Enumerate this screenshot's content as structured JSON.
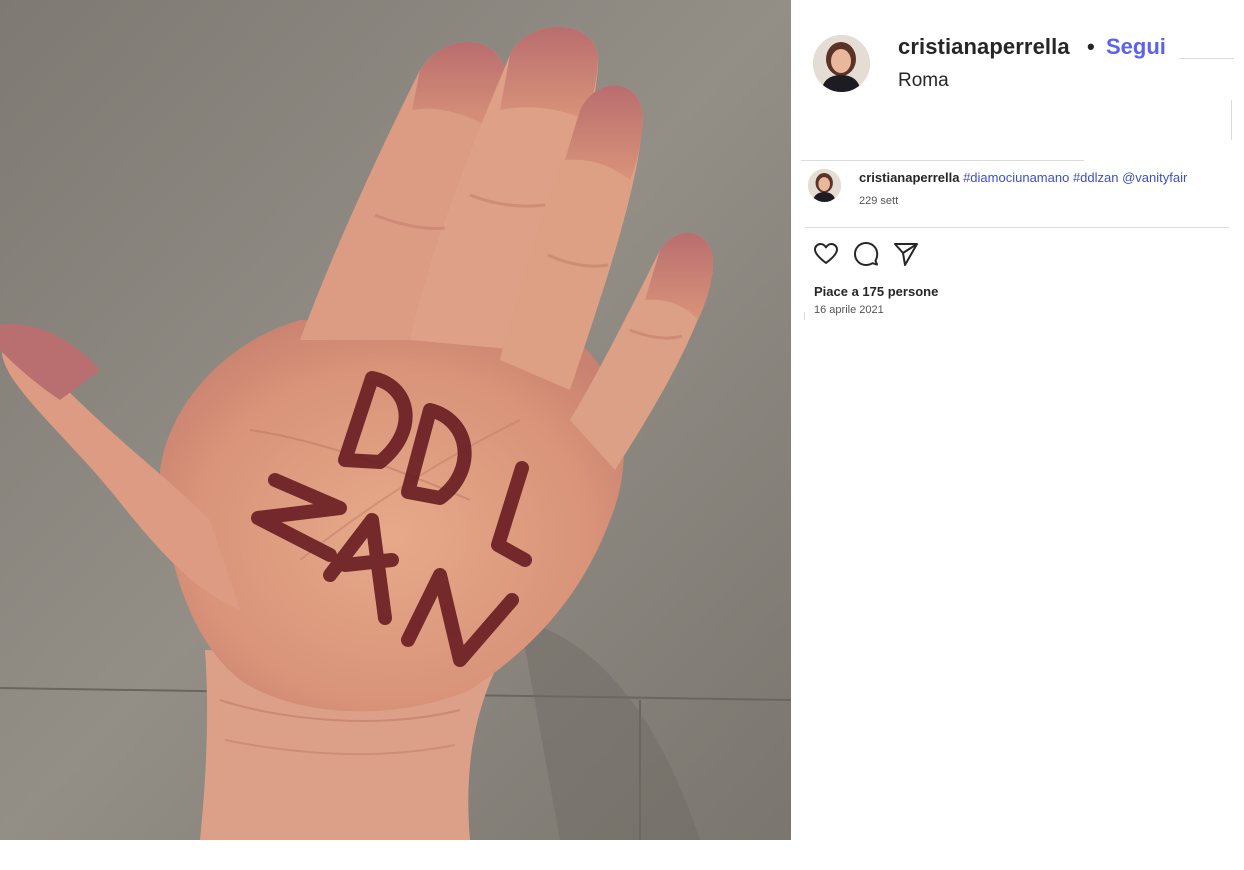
{
  "header": {
    "username": "cristianaperrella",
    "separator": "•",
    "follow_label": "Segui",
    "location": "Roma"
  },
  "caption": {
    "username": "cristianaperrella",
    "hashtags": [
      "#diamociunamano",
      "#ddlzan",
      "@vanityfair"
    ],
    "time_ago": "229 sett"
  },
  "actions": {
    "like_icon": "heart-icon",
    "comment_icon": "comment-icon",
    "share_icon": "send-icon"
  },
  "stats": {
    "likes": "Piace a 175 persone",
    "date": "16 aprile 2021"
  },
  "photo": {
    "handwriting": [
      "DDL",
      "ZAN"
    ]
  },
  "colors": {
    "follow": "#5b62ee",
    "link": "#3f4fc4",
    "ink": "#6b1f24"
  }
}
